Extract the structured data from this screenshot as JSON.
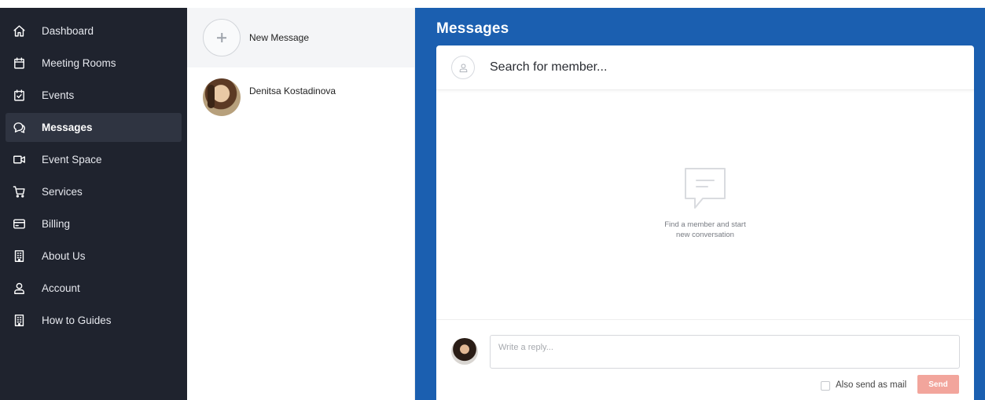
{
  "sidebar": {
    "items": [
      {
        "label": "Dashboard",
        "icon": "home-icon"
      },
      {
        "label": "Meeting Rooms",
        "icon": "calendar-icon"
      },
      {
        "label": "Events",
        "icon": "calendar-check-icon"
      },
      {
        "label": "Messages",
        "icon": "chat-bubbles-icon",
        "active": true
      },
      {
        "label": "Event Space",
        "icon": "video-camera-icon"
      },
      {
        "label": "Services",
        "icon": "shopping-cart-icon"
      },
      {
        "label": "Billing",
        "icon": "credit-card-icon"
      },
      {
        "label": "About Us",
        "icon": "building-icon"
      },
      {
        "label": "Account",
        "icon": "user-icon"
      },
      {
        "label": "How to Guides",
        "icon": "building-icon"
      }
    ]
  },
  "conversations": {
    "new_message_label": "New Message",
    "items": [
      {
        "name": "Denitsa Kostadinova"
      }
    ]
  },
  "messages": {
    "title": "Messages",
    "search_placeholder": "Search for member...",
    "empty_line1": "Find a member and start",
    "empty_line2": "new conversation",
    "reply_placeholder": "Write a reply...",
    "also_send_mail_label": "Also send as mail",
    "send_label": "Send"
  },
  "colors": {
    "sidebar_bg": "#1f232e",
    "sidebar_active_bg": "#2f3441",
    "accent_blue": "#1b5fb0",
    "send_button": "#f2a59c"
  }
}
